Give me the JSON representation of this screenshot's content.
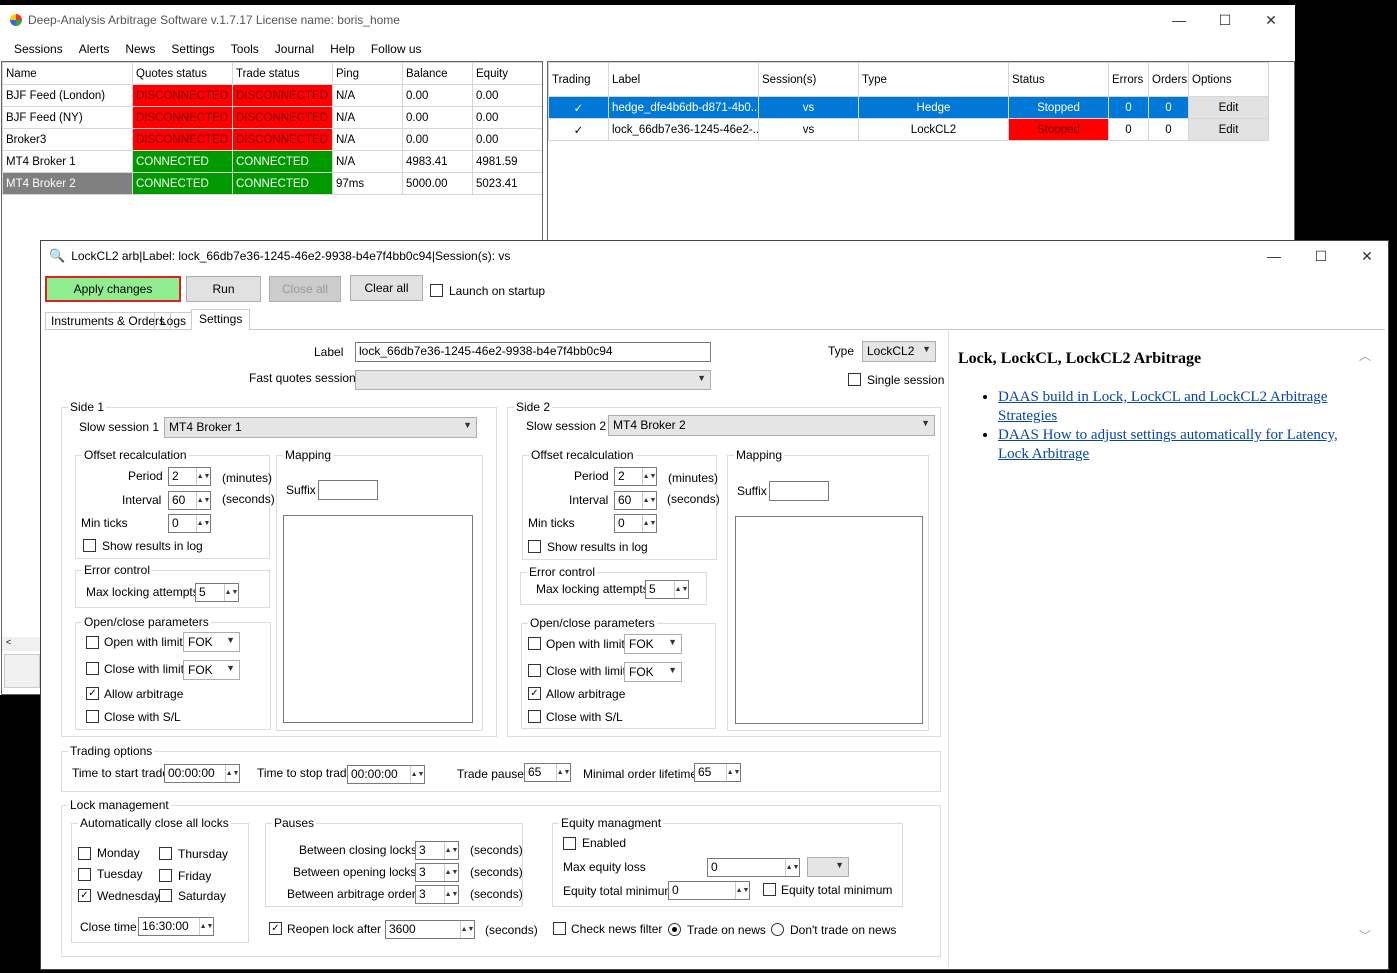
{
  "main": {
    "title": "Deep-Analysis Arbitrage Software v.1.7.17 License name: boris_home",
    "menu": [
      "Sessions",
      "Alerts",
      "News",
      "Settings",
      "Tools",
      "Journal",
      "Help",
      "Follow us"
    ]
  },
  "sessions": {
    "headers": [
      "Name",
      "Quotes status",
      "Trade status",
      "Ping",
      "Balance",
      "Equity"
    ],
    "rows": [
      [
        "BJF Feed (London)",
        "DISCONNECTED",
        "DISCONNECTED",
        "N/A",
        "0.00",
        "0.00"
      ],
      [
        "BJF Feed (NY)",
        "DISCONNECTED",
        "DISCONNECTED",
        "N/A",
        "0.00",
        "0.00"
      ],
      [
        "Broker3",
        "DISCONNECTED",
        "DISCONNECTED",
        "N/A",
        "0.00",
        "0.00"
      ],
      [
        "MT4 Broker 1",
        "CONNECTED",
        "CONNECTED",
        "N/A",
        "4983.41",
        "4981.59"
      ],
      [
        "MT4 Broker 2",
        "CONNECTED",
        "CONNECTED",
        "97ms",
        "5000.00",
        "5023.41"
      ]
    ]
  },
  "strategies": {
    "headers": [
      "Trading",
      "Label",
      "Session(s)",
      "Type",
      "Status",
      "Errors",
      "Orders",
      "Options"
    ],
    "rows": [
      [
        "✓",
        "hedge_dfe4b6db-d871-4b0...",
        "vs",
        "Hedge",
        "Stopped",
        "0",
        "0",
        "Edit"
      ],
      [
        "✓",
        "lock_66db7e36-1245-46e2-...",
        "vs",
        "LockCL2",
        "Stopped",
        "0",
        "0",
        "Edit"
      ]
    ]
  },
  "dialog": {
    "title": "LockCL2 arb|Label: lock_66db7e36-1245-46e2-9938-b4e7f4bb0c94|Session(s):  vs",
    "apply": "Apply changes",
    "run": "Run",
    "close_all": "Close all",
    "clear_all": "Clear all",
    "launch": "Launch on startup",
    "tabs": [
      "Instruments & Orders",
      "Logs",
      "Settings"
    ],
    "label_lbl": "Label",
    "label_val": "lock_66db7e36-1245-46e2-9938-b4e7f4bb0c94",
    "fast_lbl": "Fast quotes session",
    "type_lbl": "Type",
    "type_val": "LockCL2",
    "single": "Single session",
    "side1": {
      "title": "Side 1",
      "slow_lbl": "Slow session 1",
      "slow_val": "MT4 Broker 1"
    },
    "side2": {
      "title": "Side 2",
      "slow_lbl": "Slow session 2",
      "slow_val": "MT4 Broker 2"
    },
    "offset": "Offset recalculation",
    "period": "Period",
    "period_val": "2",
    "minutes": "(minutes)",
    "interval": "Interval",
    "interval_val": "60",
    "seconds": "(seconds)",
    "min_ticks": "Min ticks",
    "min_ticks_val": "0",
    "show_results": "Show results in log",
    "mapping": "Mapping",
    "suffix": "Suffix",
    "error_control": "Error control",
    "max_lock": "Max locking attempts",
    "max_lock_val": "5",
    "openclose": "Open/close parameters",
    "open_limit": "Open with limit",
    "close_limit": "Close with limit",
    "fok": "FOK",
    "allow_arb": "Allow arbitrage",
    "close_sl": "Close with S/L",
    "trading_opts": "Trading options",
    "start_lbl": "Time to start trade",
    "start_val": "00:00:00",
    "stop_lbl": "Time to stop trade",
    "stop_val": "00:00:00",
    "pause_lbl": "Trade pause",
    "pause_val": "65",
    "lifetime_lbl": "Minimal order lifetime",
    "lifetime_val": "65",
    "lock_mgmt": "Lock management",
    "auto_close": "Automatically close all locks",
    "days": [
      "Monday",
      "Tuesday",
      "Wednesday",
      "Thursday",
      "Friday",
      "Saturday"
    ],
    "close_time_lbl": "Close time",
    "close_time_val": "16:30:00",
    "pauses": "Pauses",
    "bcl": "Between closing locks",
    "bol": "Between opening locks",
    "bao": "Between arbitrage orders",
    "pause_v": "3",
    "eq_mgmt": "Equity managment",
    "enabled": "Enabled",
    "max_eq_loss": "Max equity loss",
    "max_eq_val": "0",
    "eq_total_min": "Equity total minimum",
    "eq_total_val": "0",
    "reopen": "Reopen lock after",
    "reopen_val": "3600",
    "check_news": "Check news filter",
    "trade_news": "Trade on news",
    "dont_trade": "Don't trade on news",
    "help_title": "Lock, LockCL, LockCL2 Arbitrage",
    "link1": "DAAS build in Lock, LockCL and LockCL2 Arbitrage Strategies",
    "link2": "DAAS How to adjust settings automatically for Latency, Lock Arbitrage"
  }
}
